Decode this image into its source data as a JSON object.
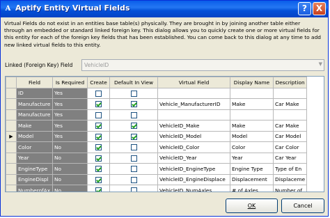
{
  "window": {
    "title": "Aptify Entity Virtual Fields",
    "icon_glyph": "A",
    "help_glyph": "?",
    "close_glyph": "X"
  },
  "description": [
    "Virtual Fields do not exist in an entities base table(s) physically. They are brought in by joining another table either",
    "through an embedded or standard linked foreign key. This dialog allows you to quickly create one or more virtual fields for",
    "this entity for each of the foreign key fields that has been established. You can come back to this dialog at any time to add",
    "new linked virtual fields to this entity."
  ],
  "linked_field": {
    "label": "Linked (Foreign Key) Field",
    "value": "VehicleID"
  },
  "grid": {
    "columns": [
      "Field",
      "Is Required",
      "Create",
      "Default In View",
      "Virtual Field",
      "Display Name",
      "Description"
    ],
    "rows": [
      {
        "marker": "",
        "field": "ID",
        "required": "Yes",
        "create": false,
        "default_in_view": false,
        "virtual_field": "",
        "display_name": "",
        "description": ""
      },
      {
        "marker": "",
        "field": "Manufacture",
        "required": "Yes",
        "create": true,
        "default_in_view": true,
        "virtual_field": "Vehicle_ManufacturerID",
        "display_name": "Make",
        "description": "Car Make"
      },
      {
        "marker": "",
        "field": "Manufacture",
        "required": "Yes",
        "create": false,
        "default_in_view": false,
        "virtual_field": "",
        "display_name": "",
        "description": ""
      },
      {
        "marker": "",
        "field": "Make",
        "required": "Yes",
        "create": true,
        "default_in_view": true,
        "virtual_field": "VehicleID_Make",
        "display_name": "Make",
        "description": "Car Make"
      },
      {
        "marker": "▶",
        "field": "Model",
        "required": "Yes",
        "create": true,
        "default_in_view": true,
        "virtual_field": "VehicleID_Model",
        "display_name": "Model",
        "description": "Car Model"
      },
      {
        "marker": "",
        "field": "Color",
        "required": "No",
        "create": true,
        "default_in_view": false,
        "virtual_field": "VehicleID_Color",
        "display_name": "Color",
        "description": "Car Color"
      },
      {
        "marker": "",
        "field": "Year",
        "required": "No",
        "create": true,
        "default_in_view": false,
        "virtual_field": "VehicleID_Year",
        "display_name": "Year",
        "description": "Car Year"
      },
      {
        "marker": "",
        "field": "EngineType",
        "required": "No",
        "create": true,
        "default_in_view": false,
        "virtual_field": "VehicleID_EngineType",
        "display_name": "Engine Type",
        "description": "Type of En"
      },
      {
        "marker": "",
        "field": "EngineDispl",
        "required": "No",
        "create": true,
        "default_in_view": false,
        "virtual_field": "VehicleID_EngineDisplace",
        "display_name": "Displacement",
        "description": "Displaceme"
      },
      {
        "marker": "",
        "field": "NumberofAx",
        "required": "No",
        "create": true,
        "default_in_view": false,
        "virtual_field": "VehicleID_NumAxles",
        "display_name": "# of Axles",
        "description": "Number of"
      }
    ]
  },
  "buttons": {
    "ok": "OK",
    "cancel": "Cancel"
  }
}
